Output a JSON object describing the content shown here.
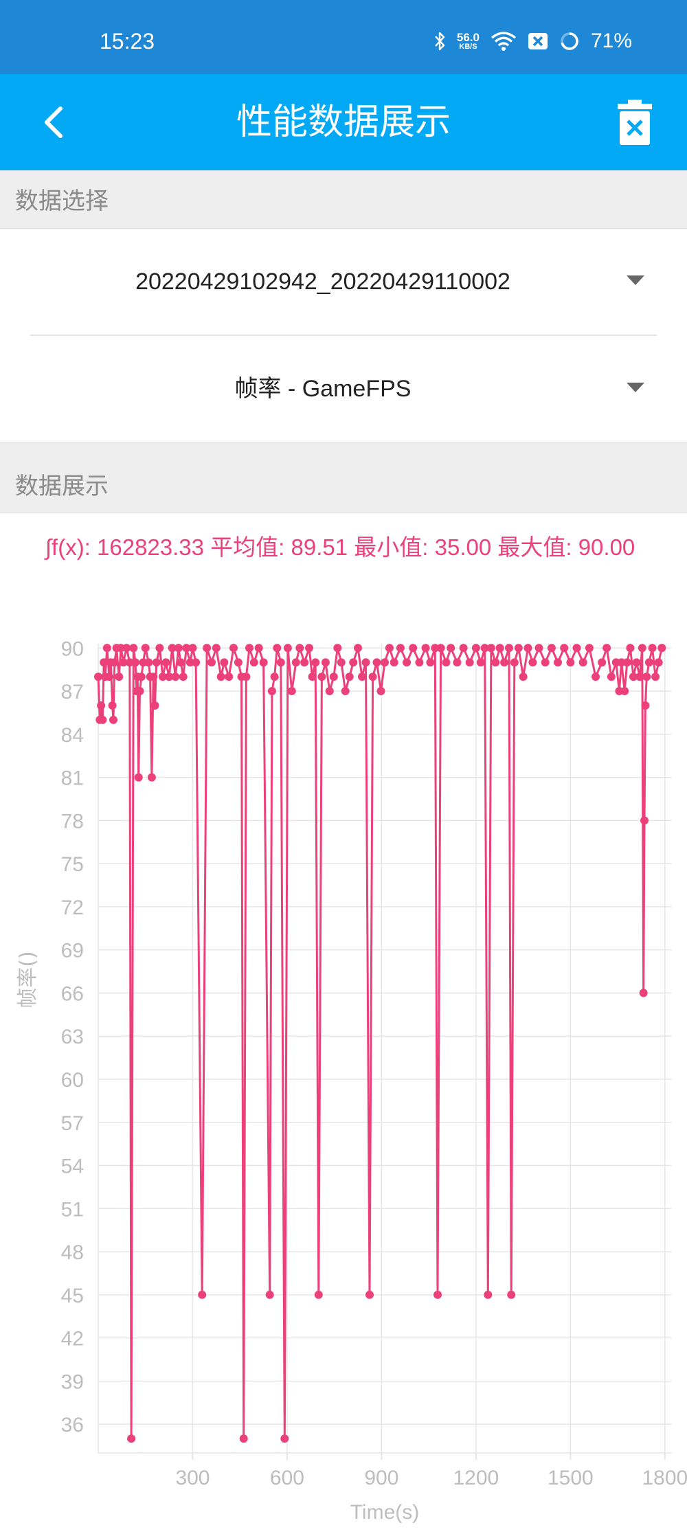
{
  "status_bar": {
    "time": "15:23",
    "net_speed_value": "56.0",
    "net_speed_unit": "KB/S",
    "battery": "71%",
    "icons": [
      "bluetooth-icon",
      "wifi-icon",
      "notification-icon",
      "battery-ring-icon"
    ]
  },
  "app_bar": {
    "title": "性能数据展示",
    "back_icon": "chevron-left-icon",
    "delete_icon": "trash-icon"
  },
  "data_select": {
    "header": "数据选择",
    "file": "20220429102942_20220429110002",
    "metric": "帧率 - GameFPS"
  },
  "data_display": {
    "header": "数据展示",
    "stats_text": "∫f(x): 162823.33 平均值: 89.51 最小值: 35.00 最大值: 90.00"
  },
  "colors": {
    "status_bar": "#1E88D6",
    "app_bar": "#03A9F4",
    "series": "#EC407A",
    "grid": "#E6E6E6",
    "axis_text": "#BDBDBD"
  },
  "chart_data": {
    "type": "line",
    "xlabel": "Time(s)",
    "ylabel": "帧率()",
    "x_ticks": [
      "300",
      "600",
      "900",
      "1200",
      "1500",
      "1800"
    ],
    "y_ticks": [
      "36",
      "39",
      "42",
      "45",
      "48",
      "51",
      "54",
      "57",
      "60",
      "63",
      "66",
      "69",
      "72",
      "75",
      "78",
      "81",
      "84",
      "87",
      "90"
    ],
    "xlim": [
      0,
      1820
    ],
    "ylim": [
      34,
      90.3
    ],
    "grid": true,
    "series": [
      {
        "values_note_free": true,
        "points": [
          [
            0,
            88
          ],
          [
            5,
            85
          ],
          [
            9,
            86
          ],
          [
            14,
            85
          ],
          [
            18,
            89
          ],
          [
            22,
            88
          ],
          [
            28,
            90
          ],
          [
            35,
            88
          ],
          [
            40,
            89
          ],
          [
            45,
            86
          ],
          [
            48,
            85
          ],
          [
            52,
            89
          ],
          [
            58,
            90
          ],
          [
            66,
            88
          ],
          [
            72,
            90
          ],
          [
            80,
            89
          ],
          [
            90,
            90
          ],
          [
            100,
            89
          ],
          [
            105,
            35
          ],
          [
            112,
            90
          ],
          [
            118,
            89
          ],
          [
            122,
            87
          ],
          [
            125,
            88
          ],
          [
            128,
            81
          ],
          [
            132,
            87
          ],
          [
            137,
            88
          ],
          [
            143,
            89
          ],
          [
            150,
            90
          ],
          [
            160,
            89
          ],
          [
            165,
            88
          ],
          [
            170,
            81
          ],
          [
            175,
            88
          ],
          [
            180,
            86
          ],
          [
            185,
            89
          ],
          [
            195,
            90
          ],
          [
            205,
            88
          ],
          [
            215,
            89
          ],
          [
            225,
            88
          ],
          [
            235,
            90
          ],
          [
            245,
            88
          ],
          [
            255,
            90
          ],
          [
            262,
            89
          ],
          [
            270,
            88
          ],
          [
            280,
            90
          ],
          [
            292,
            89
          ],
          [
            300,
            90
          ],
          [
            310,
            89
          ],
          [
            330,
            45
          ],
          [
            345,
            90
          ],
          [
            360,
            89
          ],
          [
            375,
            90
          ],
          [
            390,
            88
          ],
          [
            400,
            89
          ],
          [
            415,
            88
          ],
          [
            430,
            90
          ],
          [
            445,
            89
          ],
          [
            455,
            88
          ],
          [
            462,
            35
          ],
          [
            470,
            88
          ],
          [
            480,
            90
          ],
          [
            495,
            89
          ],
          [
            510,
            90
          ],
          [
            525,
            89
          ],
          [
            545,
            45
          ],
          [
            552,
            87
          ],
          [
            560,
            88
          ],
          [
            568,
            90
          ],
          [
            580,
            89
          ],
          [
            592,
            35
          ],
          [
            602,
            90
          ],
          [
            615,
            87
          ],
          [
            628,
            89
          ],
          [
            640,
            90
          ],
          [
            655,
            89
          ],
          [
            670,
            90
          ],
          [
            680,
            88
          ],
          [
            690,
            89
          ],
          [
            700,
            45
          ],
          [
            710,
            88
          ],
          [
            722,
            89
          ],
          [
            735,
            87
          ],
          [
            748,
            88
          ],
          [
            760,
            90
          ],
          [
            772,
            89
          ],
          [
            785,
            87
          ],
          [
            798,
            88
          ],
          [
            810,
            89
          ],
          [
            825,
            90
          ],
          [
            838,
            88
          ],
          [
            850,
            89
          ],
          [
            862,
            45
          ],
          [
            872,
            88
          ],
          [
            885,
            89
          ],
          [
            898,
            87
          ],
          [
            910,
            89
          ],
          [
            925,
            90
          ],
          [
            940,
            89
          ],
          [
            960,
            90
          ],
          [
            980,
            89
          ],
          [
            1000,
            90
          ],
          [
            1020,
            89
          ],
          [
            1040,
            90
          ],
          [
            1055,
            89
          ],
          [
            1070,
            90
          ],
          [
            1078,
            45
          ],
          [
            1088,
            90
          ],
          [
            1105,
            89
          ],
          [
            1120,
            90
          ],
          [
            1140,
            89
          ],
          [
            1160,
            90
          ],
          [
            1180,
            89
          ],
          [
            1200,
            90
          ],
          [
            1215,
            89
          ],
          [
            1228,
            90
          ],
          [
            1238,
            45
          ],
          [
            1248,
            90
          ],
          [
            1262,
            89
          ],
          [
            1276,
            90
          ],
          [
            1290,
            89
          ],
          [
            1305,
            90
          ],
          [
            1312,
            45
          ],
          [
            1322,
            89
          ],
          [
            1335,
            90
          ],
          [
            1350,
            88
          ],
          [
            1365,
            90
          ],
          [
            1380,
            89
          ],
          [
            1400,
            90
          ],
          [
            1420,
            89
          ],
          [
            1440,
            90
          ],
          [
            1460,
            89
          ],
          [
            1480,
            90
          ],
          [
            1500,
            89
          ],
          [
            1520,
            90
          ],
          [
            1540,
            89
          ],
          [
            1560,
            90
          ],
          [
            1580,
            88
          ],
          [
            1600,
            89
          ],
          [
            1615,
            90
          ],
          [
            1630,
            88
          ],
          [
            1645,
            89
          ],
          [
            1655,
            87
          ],
          [
            1662,
            89
          ],
          [
            1672,
            87
          ],
          [
            1680,
            89
          ],
          [
            1690,
            90
          ],
          [
            1700,
            88
          ],
          [
            1710,
            89
          ],
          [
            1720,
            88
          ],
          [
            1728,
            90
          ],
          [
            1732,
            66
          ],
          [
            1735,
            78
          ],
          [
            1738,
            86
          ],
          [
            1742,
            88
          ],
          [
            1750,
            89
          ],
          [
            1760,
            90
          ],
          [
            1770,
            88
          ],
          [
            1780,
            89
          ],
          [
            1790,
            90
          ]
        ]
      }
    ]
  }
}
